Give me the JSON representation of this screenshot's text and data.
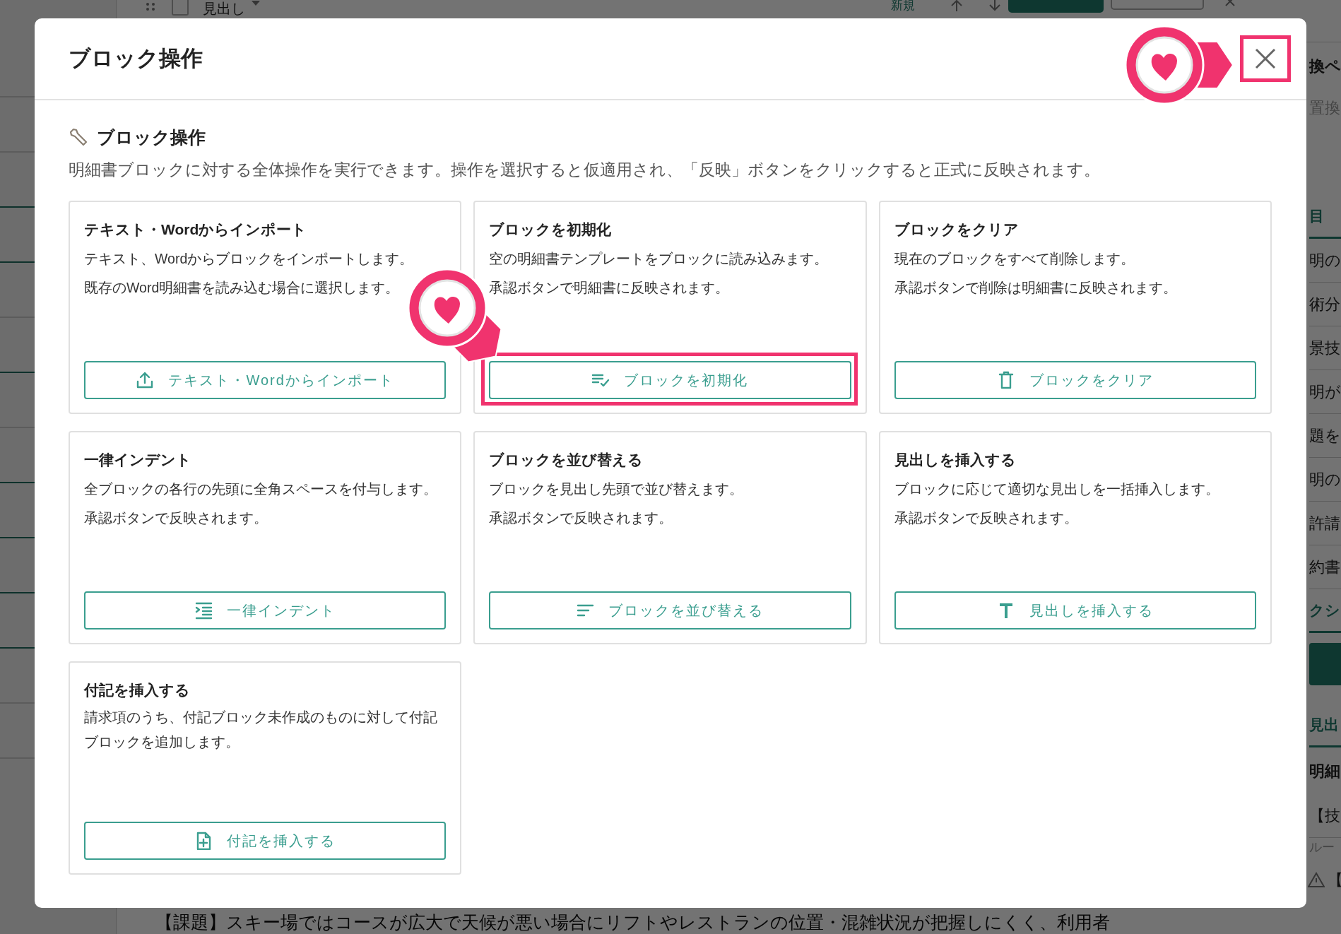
{
  "background": {
    "toolbar": {
      "checked": false,
      "heading_select": "見出し",
      "new_link": "新規"
    },
    "side_panel": [
      {
        "kind": "heading",
        "text": "換ペ"
      },
      {
        "kind": "field",
        "text": "置換"
      },
      {
        "kind": "tab",
        "text": "目"
      },
      {
        "kind": "item",
        "text": "明の"
      },
      {
        "kind": "item",
        "text": "術分"
      },
      {
        "kind": "item",
        "text": "景技"
      },
      {
        "kind": "item",
        "text": "明が"
      },
      {
        "kind": "item",
        "text": "題を"
      },
      {
        "kind": "item",
        "text": "明の"
      },
      {
        "kind": "item",
        "text": "許請"
      },
      {
        "kind": "item",
        "text": "約書"
      },
      {
        "kind": "tab",
        "text": "クシ"
      },
      {
        "kind": "bar"
      },
      {
        "kind": "tab",
        "text": "見出"
      },
      {
        "kind": "heading",
        "text": "明細"
      },
      {
        "kind": "item",
        "text": "【技"
      },
      {
        "kind": "note",
        "text": "ルー"
      },
      {
        "kind": "warning",
        "text": "【"
      }
    ],
    "editor_text": "【課題】スキー場ではコースが広大で天候が悪い場合にリフトやレストランの位置・混雑状況が把握しにくく、利用者"
  },
  "modal": {
    "title": "ブロック操作",
    "close": {
      "highlighted": true
    },
    "section_title": "ブロック操作",
    "description": "明細書ブロックに対する全体操作を実行できます。操作を選択すると仮適用され、「反映」ボタンをクリックすると正式に反映されます。",
    "operations": [
      {
        "title": "テキスト・Wordからインポート",
        "lines": [
          "テキスト、Wordからブロックをインポートします。",
          "既存のWord明細書を読み込む場合に選択します。"
        ],
        "button": "テキスト・Wordからインポート",
        "highlighted": false
      },
      {
        "title": "ブロックを初期化",
        "lines": [
          "空の明細書テンプレートをブロックに読み込みます。",
          "承認ボタンで明細書に反映されます。"
        ],
        "button": "ブロックを初期化",
        "highlighted": true
      },
      {
        "title": "ブロックをクリア",
        "lines": [
          "現在のブロックをすべて削除します。",
          "承認ボタンで削除は明細書に反映されます。"
        ],
        "button": "ブロックをクリア",
        "highlighted": false
      },
      {
        "title": "一律インデント",
        "lines": [
          "全ブロックの各行の先頭に全角スペースを付与します。",
          "承認ボタンで反映されます。"
        ],
        "button": "一律インデント",
        "highlighted": false
      },
      {
        "title": "ブロックを並び替える",
        "lines": [
          "ブロックを見出し先頭で並び替えます。",
          "承認ボタンで反映されます。"
        ],
        "button": "ブロックを並び替える",
        "highlighted": false
      },
      {
        "title": "見出しを挿入する",
        "lines": [
          "ブロックに応じて適切な見出しを一括挿入します。",
          "承認ボタンで反映されます。"
        ],
        "button": "見出しを挿入する",
        "highlighted": false
      },
      {
        "title": "付記を挿入する",
        "lines": [
          "請求項のうち、付記ブロック未作成のものに対して付記ブロックを追加します。"
        ],
        "button": "付記を挿入する",
        "highlighted": false
      }
    ]
  }
}
